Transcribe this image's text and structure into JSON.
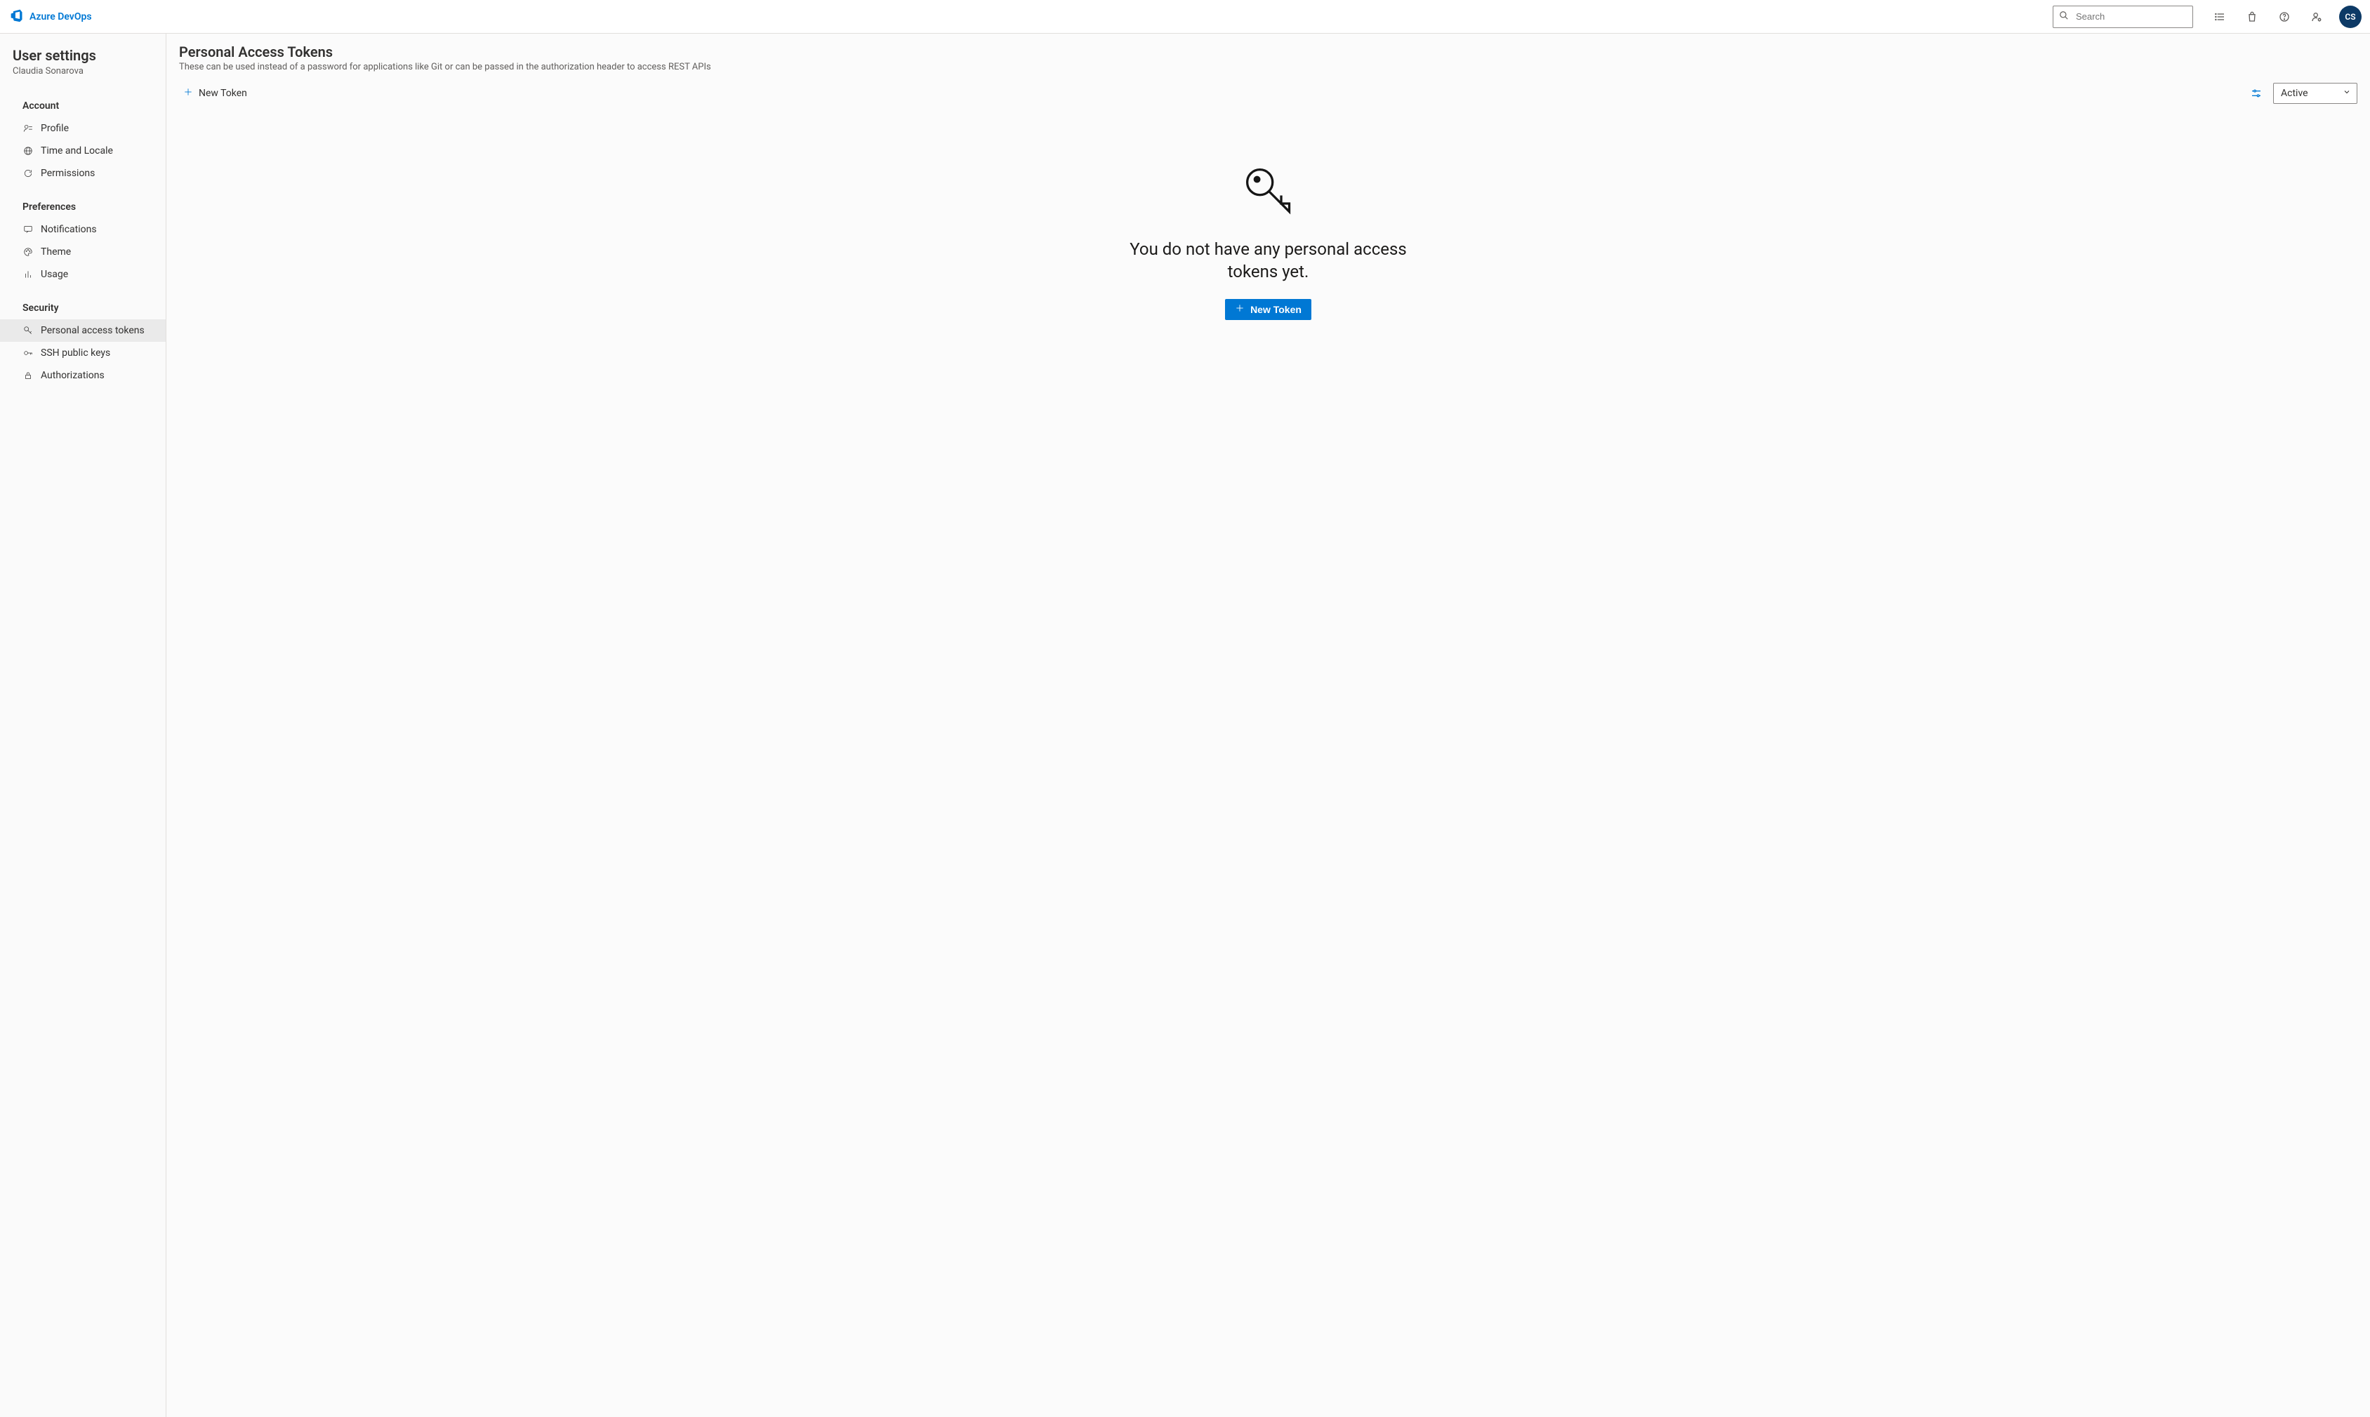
{
  "header": {
    "brand": "Azure DevOps",
    "search_placeholder": "Search",
    "avatar_initials": "CS"
  },
  "sidebar": {
    "title": "User settings",
    "user_name": "Claudia Sonarova",
    "groups": [
      {
        "title": "Account",
        "items": [
          {
            "label": "Profile",
            "icon": "profile"
          },
          {
            "label": "Time and Locale",
            "icon": "globe"
          },
          {
            "label": "Permissions",
            "icon": "refresh"
          }
        ]
      },
      {
        "title": "Preferences",
        "items": [
          {
            "label": "Notifications",
            "icon": "chat"
          },
          {
            "label": "Theme",
            "icon": "palette"
          },
          {
            "label": "Usage",
            "icon": "bars"
          }
        ]
      },
      {
        "title": "Security",
        "items": [
          {
            "label": "Personal access tokens",
            "icon": "key",
            "selected": true
          },
          {
            "label": "SSH public keys",
            "icon": "ssh"
          },
          {
            "label": "Authorizations",
            "icon": "lock"
          }
        ]
      }
    ]
  },
  "main": {
    "title": "Personal Access Tokens",
    "description": "These can be used instead of a password for applications like Git or can be passed in the authorization header to access REST APIs",
    "toolbar": {
      "new_label": "New Token",
      "filter_selected": "Active"
    },
    "empty_state": {
      "message": "You do not have any personal access tokens yet.",
      "button_label": "New Token"
    }
  }
}
